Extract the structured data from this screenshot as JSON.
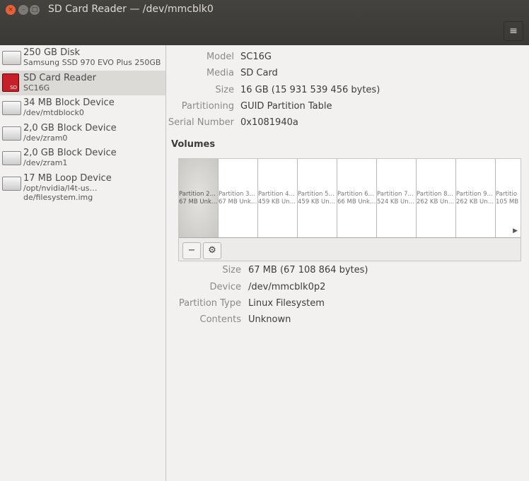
{
  "window": {
    "title": "SD Card Reader — /dev/mmcblk0",
    "close": "×",
    "minimize": "–",
    "maximize": "□",
    "menu": "≡"
  },
  "sidebar": {
    "items": [
      {
        "title": "250 GB Disk",
        "subtitle": "Samsung SSD 970 EVO Plus 250GB",
        "icon": "hdd"
      },
      {
        "title": "SD Card Reader",
        "subtitle": "SC16G",
        "icon": "sd",
        "icon_text": "SD"
      },
      {
        "title": "34 MB Block Device",
        "subtitle": "/dev/mtdblock0",
        "icon": "drive"
      },
      {
        "title": "2,0 GB Block Device",
        "subtitle": "/dev/zram0",
        "icon": "drive"
      },
      {
        "title": "2,0 GB Block Device",
        "subtitle": "/dev/zram1",
        "icon": "drive"
      },
      {
        "title": "17 MB Loop Device",
        "subtitle": "/opt/nvidia/l4t-us…de/filesystem.img",
        "icon": "drive"
      }
    ]
  },
  "drive": {
    "model_label": "Model",
    "model": "SC16G",
    "media_label": "Media",
    "media": "SD Card",
    "size_label": "Size",
    "size": "16 GB (15 931 539 456 bytes)",
    "partitioning_label": "Partitioning",
    "partitioning": "GUID Partition Table",
    "serial_label": "Serial Number",
    "serial": "0x1081940a"
  },
  "volumes": {
    "heading": "Volumes",
    "partitions": [
      {
        "name": "Partition 2…",
        "info": "67 MB Unk…"
      },
      {
        "name": "Partition 3…",
        "info": "67 MB Unk…"
      },
      {
        "name": "Partition 4…",
        "info": "459 KB Un…"
      },
      {
        "name": "Partition 5…",
        "info": "459 KB Un…"
      },
      {
        "name": "Partition 6…",
        "info": "66 MB Unk…"
      },
      {
        "name": "Partition 7…",
        "info": "524 KB Un…"
      },
      {
        "name": "Partition 8…",
        "info": "262 KB Un…"
      },
      {
        "name": "Partition 9…",
        "info": "262 KB Un…"
      },
      {
        "name": "Partitio",
        "info": "105 MB"
      }
    ],
    "scroll_arrow": "▶",
    "remove": "−",
    "settings": "⚙"
  },
  "partition": {
    "size_label": "Size",
    "size": "67 MB (67 108 864 bytes)",
    "device_label": "Device",
    "device": "/dev/mmcblk0p2",
    "type_label": "Partition Type",
    "type": "Linux Filesystem",
    "contents_label": "Contents",
    "contents": "Unknown"
  }
}
